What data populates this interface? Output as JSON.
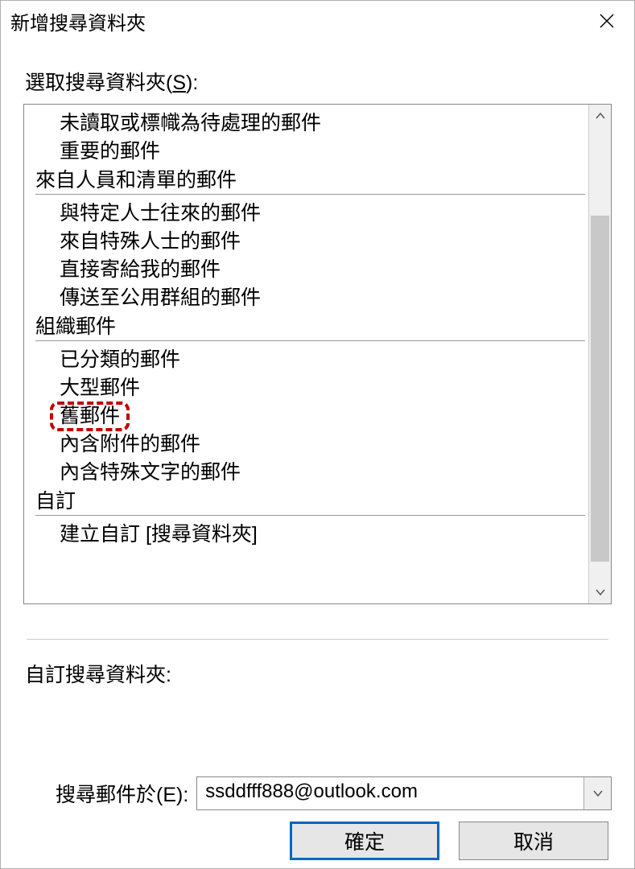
{
  "title": "新增搜尋資料夾",
  "select_label_prefix": "選取搜尋資料夾(",
  "select_label_key": "S",
  "select_label_suffix": "):",
  "list": {
    "items_top": [
      "未讀取或標幟為待處理的郵件",
      "重要的郵件"
    ],
    "group1": "來自人員和清單的郵件",
    "group1_items": [
      "與特定人士往來的郵件",
      "來自特殊人士的郵件",
      "直接寄給我的郵件",
      "傳送至公用群組的郵件"
    ],
    "group2": "組織郵件",
    "group2_items": [
      "已分類的郵件",
      "大型郵件",
      "舊郵件",
      "內含附件的郵件",
      "內含特殊文字的郵件"
    ],
    "group3": "自訂",
    "group3_items": [
      "建立自訂 [搜尋資料夾]"
    ]
  },
  "highlighted_index": 2,
  "custom_label": "自訂搜尋資料夾:",
  "search_label_prefix": "搜尋郵件於(",
  "search_label_key": "E",
  "search_label_suffix": "):",
  "mailbox": "ssddfff888@outlook.com",
  "ok_label": "確定",
  "cancel_label": "取消"
}
